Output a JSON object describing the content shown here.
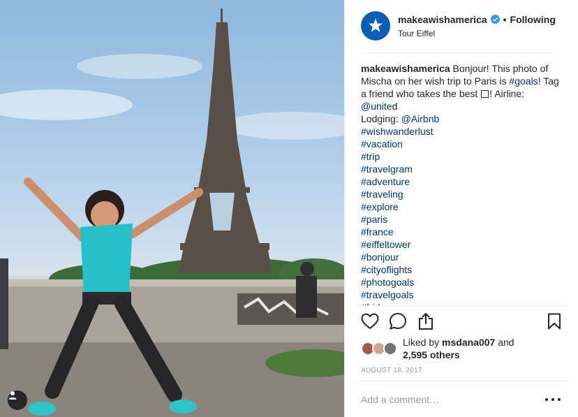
{
  "post": {
    "username": "makeawishamerica",
    "follow_status": "Following",
    "separator": "•",
    "location": "Tour Eiffel"
  },
  "caption": {
    "username": "makeawishamerica",
    "text_1": "Bonjour! This photo of Mischa on her wish trip to Paris is",
    "hashtag_goals": "#goals",
    "text_2": "! Tag a friend who takes the best",
    "text_3": "! Airline:",
    "mention_united": "@united",
    "lodging_label": "Lodging:",
    "mention_airbnb": "@Airbnb",
    "hashtags": [
      "#wishwanderlust",
      "#vacation",
      "#trip",
      "#travelgram",
      "#adventure",
      "#traveling",
      "#explore",
      "#paris",
      "#france",
      "#eiffeltower",
      "#bonjour",
      "#cityoflights",
      "#photogoals",
      "#travelgoals",
      "#friday"
    ]
  },
  "likes": {
    "prefix": "Liked by",
    "user": "msdana007",
    "conjunction": "and",
    "others": "2,595 others"
  },
  "date": "AUGUST 18, 2017",
  "comment": {
    "placeholder": "Add a comment…"
  },
  "icons": {
    "avatar": "star-logo",
    "verified": "verified-badge-icon",
    "like": "heart-icon",
    "comment": "comment-icon",
    "share": "share-icon",
    "save": "bookmark-icon",
    "more": "more-options-icon",
    "tags": "user-tag-icon"
  },
  "colors": {
    "link": "#003569",
    "verified": "#3897f0",
    "avatar_bg": "#0a5fb4"
  }
}
